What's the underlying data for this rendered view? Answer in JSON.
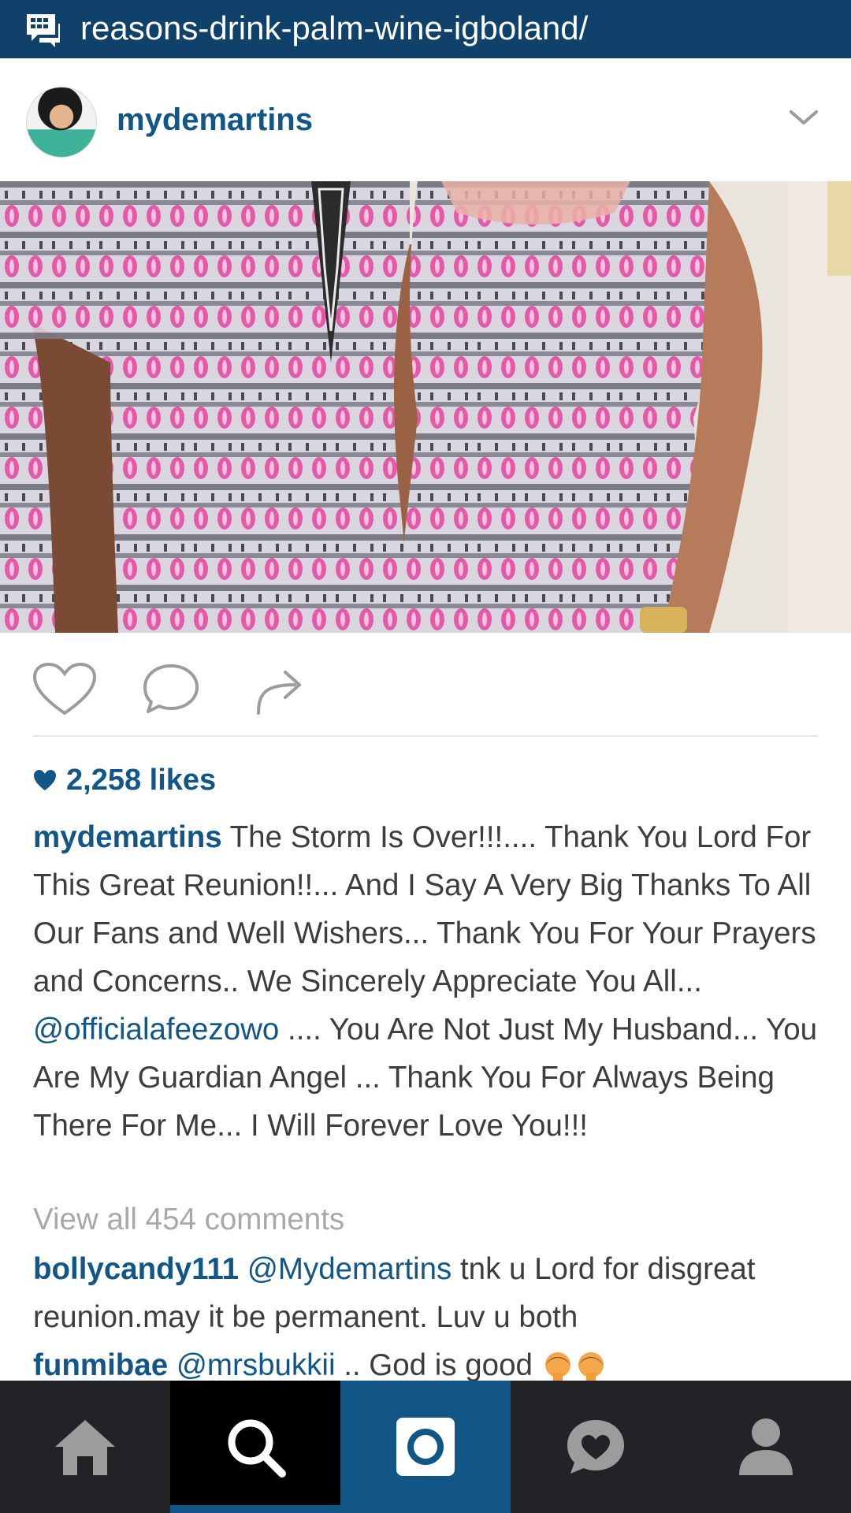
{
  "topbar": {
    "url": "reasons-drink-palm-wine-igboland/",
    "icon": "bbm-chat-icon"
  },
  "post": {
    "username": "mydemartins",
    "likes": "2,258 likes",
    "caption": {
      "user": "mydemartins",
      "text_part1": " The Storm Is Over!!!.... Thank You Lord For This Great Reunion!!... And I Say A Very Big Thanks To All Our Fans and Well Wishers... Thank You For Your Prayers and Concerns.. We Sincerely Appreciate You All... ",
      "mention": "@officialafeezowo",
      "text_part2": " .... You Are Not Just My Husband... You Are My Guardian Angel ... Thank You For Always Being There For Me... I Will Forever Love You!!!"
    },
    "view_all_comments": "View all 454 comments",
    "comments": [
      {
        "user": "bollycandy111",
        "mention": "@Mydemartins",
        "text": " tnk u Lord for disgreat reunion.may it be permanent. Luv u both"
      },
      {
        "user": "funmibae",
        "mention": "@mrsbukkii",
        "text": " .. God is good "
      }
    ]
  },
  "colors": {
    "topbar": "#0f416a",
    "brand_blue": "#125688",
    "text": "#3d3d3d",
    "muted": "#a8a8a8",
    "nav_bg": "#222326"
  },
  "bottom_nav": [
    "home-icon",
    "search-icon",
    "camera-icon",
    "activity-heart-icon",
    "profile-icon"
  ]
}
